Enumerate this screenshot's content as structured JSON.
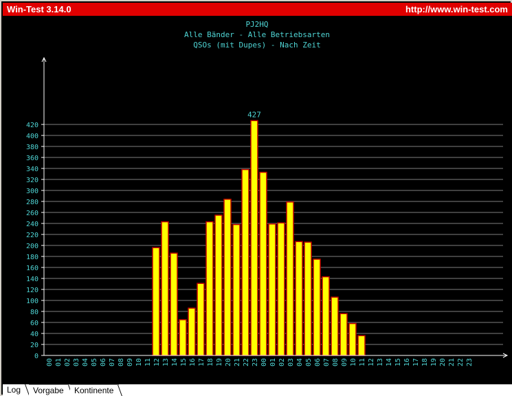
{
  "window": {
    "title": "Win-Test 3.14.0",
    "url": "http://www.win-test.com"
  },
  "tabs": [
    "Log",
    "Vorgabe",
    "Kontinente"
  ],
  "colors": {
    "background": "#000000",
    "titlebar": "#e00000",
    "bar_fill": "#ffff00",
    "bar_border": "#c00000",
    "text": "#4fd5d5",
    "axis": "#ffffff",
    "grid": "#808080"
  },
  "chart_data": {
    "type": "bar",
    "title": "PJ2HQ",
    "subtitle": "Alle Bänder - Alle Betriebsarten",
    "subtitle2": "QSOs (mit Dupes) - Nach Zeit",
    "xlabel": "",
    "ylabel": "",
    "ylim": [
      0,
      420
    ],
    "ytick_step": 20,
    "grid": true,
    "peak_label": "427",
    "categories": [
      "00",
      "01",
      "02",
      "03",
      "04",
      "05",
      "06",
      "07",
      "08",
      "09",
      "10",
      "11",
      "12",
      "13",
      "14",
      "15",
      "16",
      "17",
      "18",
      "19",
      "20",
      "21",
      "22",
      "23",
      "00",
      "01",
      "02",
      "03",
      "04",
      "05",
      "06",
      "07",
      "08",
      "09",
      "10",
      "11",
      "12",
      "13",
      "14",
      "15",
      "16",
      "17",
      "18",
      "19",
      "20",
      "21",
      "22",
      "23"
    ],
    "values": [
      0,
      0,
      0,
      0,
      0,
      0,
      0,
      0,
      0,
      0,
      0,
      0,
      196,
      243,
      186,
      65,
      86,
      131,
      243,
      255,
      284,
      238,
      338,
      427,
      333,
      239,
      241,
      279,
      207,
      206,
      175,
      143,
      106,
      76,
      58,
      36,
      0,
      0,
      0,
      0,
      0,
      0,
      0,
      0,
      0,
      0,
      0,
      0
    ]
  }
}
